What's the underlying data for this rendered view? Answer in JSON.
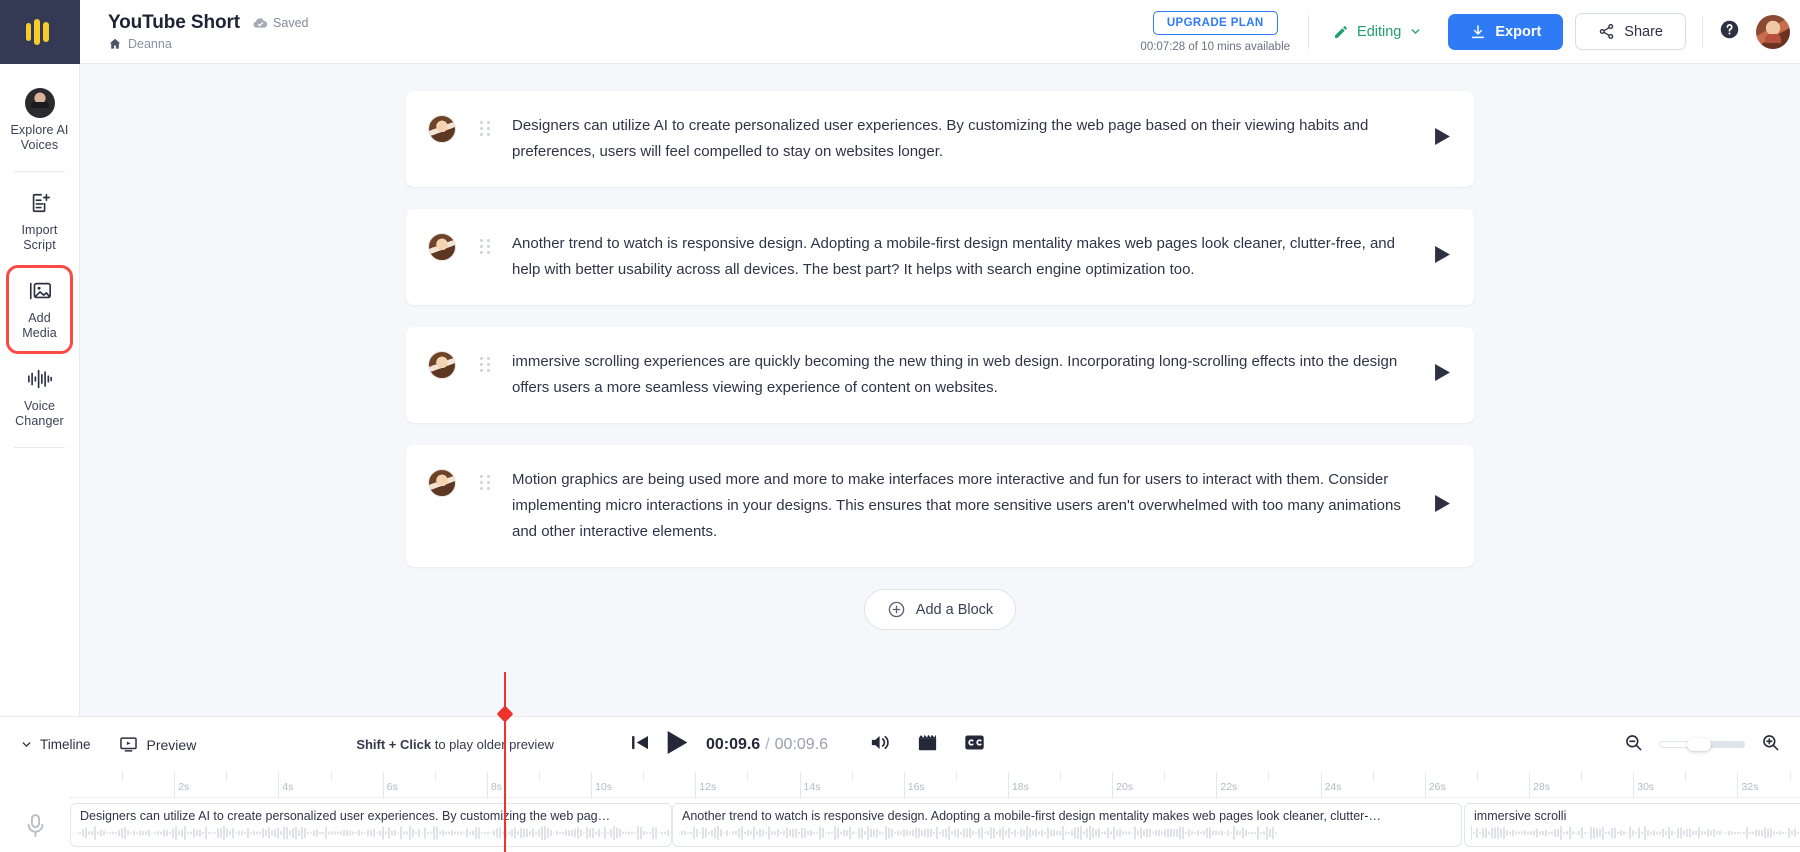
{
  "brand": {
    "logo_icon": "app-logo-icon",
    "logo_color": "#f5cb2e",
    "logo_bg": "#343a54"
  },
  "sidebar": {
    "items": [
      {
        "label_line1": "Explore AI",
        "label_line2": "Voices",
        "icon": "ai-voice-avatar-icon",
        "highlighted": false
      },
      {
        "label_line1": "Import",
        "label_line2": "Script",
        "icon": "import-script-icon",
        "highlighted": false
      },
      {
        "label_line1": "Add Media",
        "label_line2": "",
        "icon": "add-media-icon",
        "highlighted": true
      },
      {
        "label_line1": "Voice",
        "label_line2": "Changer",
        "icon": "voice-changer-icon",
        "highlighted": false
      }
    ]
  },
  "header": {
    "title": "YouTube Short",
    "saved_label": "Saved",
    "saved_icon": "cloud-check-icon",
    "breadcrumb_icon": "home-icon",
    "breadcrumb_label": "Deanna",
    "upgrade_label": "UPGRADE PLAN",
    "plan_usage": "00:07:28 of 10 mins available",
    "mode_label": "Editing",
    "mode_icon": "pencil-icon",
    "mode_chevron_icon": "chevron-down-icon",
    "export_label": "Export",
    "export_icon": "download-icon",
    "share_label": "Share",
    "share_icon": "share-nodes-icon",
    "help_icon": "help-circle-icon",
    "avatar_icon": "user-avatar",
    "accent_blue": "#2f7bf6",
    "accent_green": "#22a06b",
    "highlight_red": "#fb4a44"
  },
  "script": {
    "blocks": [
      {
        "text": "Designers can utilize AI to create personalized user experiences. By customizing the web page based on their viewing habits and preferences, users will feel compelled to stay on websites longer."
      },
      {
        "text": "Another trend to watch is responsive design. Adopting a mobile-first design mentality makes web pages look cleaner, clutter-free, and help with better usability across all devices. The best part? It helps with search engine optimization too."
      },
      {
        "text": "immersive scrolling experiences are quickly becoming the new thing in web design. Incorporating long-scrolling effects into the design offers users a more seamless viewing experience of content on websites."
      },
      {
        "text": "Motion graphics are being used more and more to make interfaces more interactive and fun for users to interact with them. Consider implementing micro interactions in your designs. This ensures that more sensitive users aren't overwhelmed with too many animations and other interactive elements."
      }
    ],
    "add_block_label": "Add a Block",
    "add_block_icon": "plus-circle-icon",
    "play_icon": "play-icon",
    "drag_icon": "drag-handle-icon",
    "avatar_icon": "speaker-avatar"
  },
  "transport": {
    "timeline_label": "Timeline",
    "timeline_chevron_icon": "chevron-down-icon",
    "preview_label": "Preview",
    "preview_icon": "preview-monitor-icon",
    "hint_bold": "Shift + Click",
    "hint_rest": " to play older preview",
    "skip_start_icon": "skip-to-start-icon",
    "play_icon": "play-icon",
    "current_time": "00:09.6",
    "time_separator": "/",
    "total_time": "00:09.6",
    "volume_icon": "volume-icon",
    "scene_icon": "clapperboard-icon",
    "caption_icon": "closed-caption-icon",
    "zoom_out_icon": "zoom-out-icon",
    "zoom_in_icon": "zoom-in-icon",
    "zoom_slider_name": "timeline-zoom-slider"
  },
  "timeline": {
    "mic_icon": "microphone-icon",
    "playhead_position_seconds": 9.6,
    "ruler_ticks": [
      "2s",
      "4s",
      "6s",
      "8s",
      "10s",
      "12s",
      "14s",
      "16s",
      "18s",
      "20s",
      "22s",
      "24s",
      "26s",
      "28s",
      "30s",
      "32s"
    ],
    "clips": [
      {
        "text": "Designers can utilize AI to create personalized user experiences. By customizing the web pag…"
      },
      {
        "text": "Another trend to watch is responsive design. Adopting a mobile-first design mentality makes web pages look cleaner, clutter-…"
      },
      {
        "text": "immersive scrolli"
      }
    ]
  }
}
